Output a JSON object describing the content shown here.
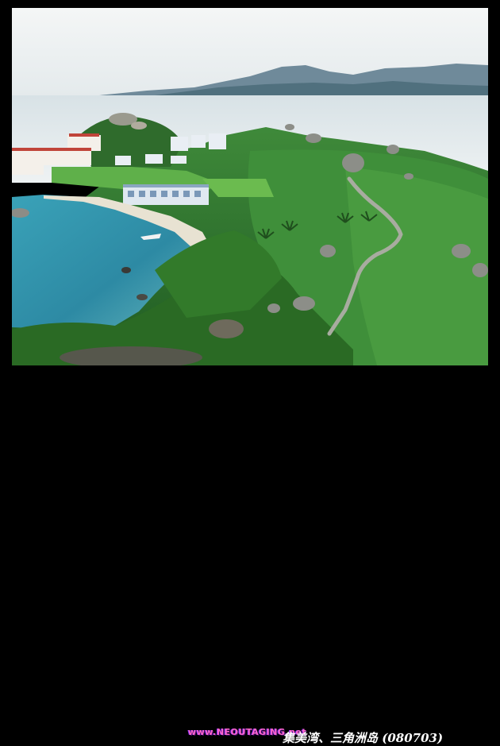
{
  "caption": {
    "watermark": "www.NEOUTAGING.net",
    "title": "集美湾、三角洲岛 (080703)"
  }
}
